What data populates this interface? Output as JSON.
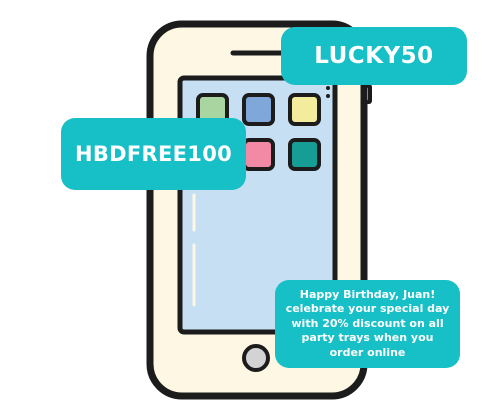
{
  "colors": {
    "bubble": "#17bfc7",
    "phone_outline": "#1c1c1c",
    "phone_body": "#fdf7e3",
    "screen": "#c6dff2",
    "app_green": "#a8d5a0",
    "app_blue": "#7fa7d9",
    "app_yellow": "#f3ec9c",
    "app_purple": "#a59acb",
    "app_pink": "#f28aa5",
    "app_teal": "#169e96",
    "home_button": "#d3d3d3"
  },
  "phone": {
    "apps": [
      "green-app",
      "blue-app",
      "yellow-app",
      "purple-app",
      "pink-app",
      "teal-app"
    ]
  },
  "codes": {
    "lucky": "LUCKY50",
    "birthday": "HBDFREE100"
  },
  "message": {
    "text": "Happy Birthday, Juan! celebrate your special day with 20% discount on all party trays when you order online"
  }
}
